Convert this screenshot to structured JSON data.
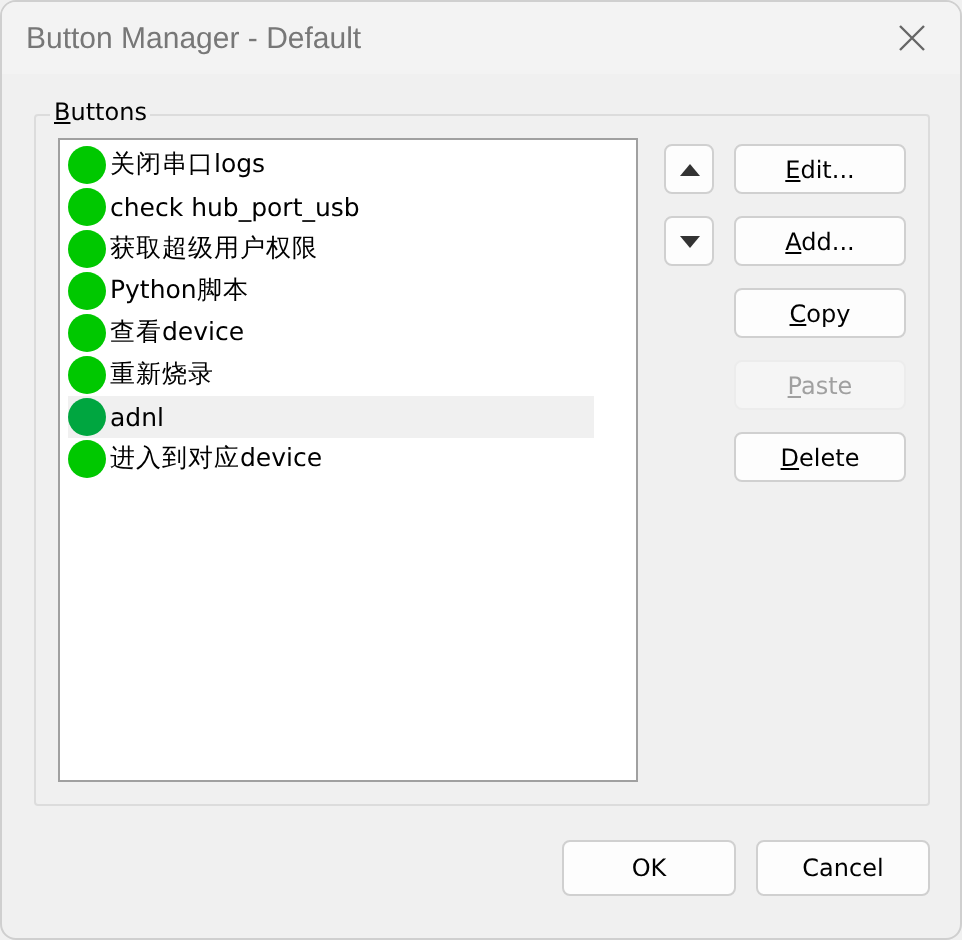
{
  "window": {
    "title": "Button Manager - Default"
  },
  "group": {
    "access": "B",
    "rest": "uttons"
  },
  "items": [
    {
      "label": "关闭串口logs",
      "selected": false
    },
    {
      "label": "check hub_port_usb",
      "selected": false
    },
    {
      "label": "获取超级用户权限",
      "selected": false
    },
    {
      "label": "Python脚本",
      "selected": false
    },
    {
      "label": "查看device",
      "selected": false
    },
    {
      "label": "重新烧录",
      "selected": false
    },
    {
      "label": "adnl",
      "selected": true
    },
    {
      "label": "进入到对应device",
      "selected": false
    }
  ],
  "move_buttons": [
    {
      "kind": "up"
    },
    {
      "kind": "down"
    }
  ],
  "actions": [
    {
      "access": "E",
      "rest": "dit...",
      "disabled": false
    },
    {
      "access": "A",
      "rest": "dd...",
      "disabled": false
    },
    {
      "access": "C",
      "rest": "opy",
      "disabled": false
    },
    {
      "access": "P",
      "rest": "aste",
      "disabled": true
    },
    {
      "access": "D",
      "rest": "elete",
      "disabled": false
    }
  ],
  "footer": [
    {
      "label": "OK"
    },
    {
      "label": "Cancel"
    }
  ]
}
